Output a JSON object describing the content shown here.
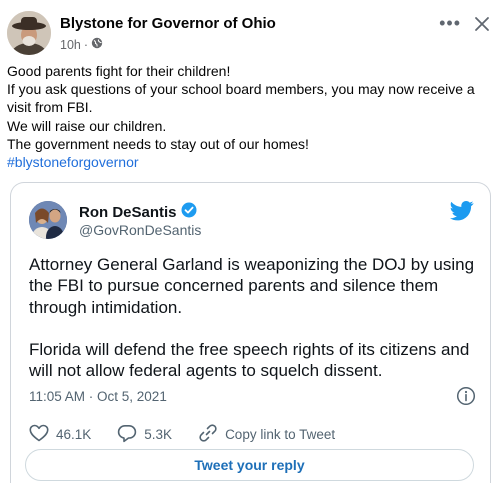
{
  "post": {
    "author": "Blystone for Governor of Ohio",
    "time": "10h",
    "separator": "·",
    "more_label": "•••",
    "lines": [
      "Good parents fight for their children!",
      "If you ask questions of your school board members, you may now receive a visit from FBI.",
      "We will raise our children.",
      "The government needs to stay out of our homes!"
    ],
    "hashtag": "#blystoneforgovernor"
  },
  "tweet": {
    "name": "Ron DeSantis",
    "handle": "@GovRonDeSantis",
    "paragraphs": [
      "Attorney General Garland is weaponizing the DOJ by using the FBI to pursue concerned parents and silence them through intimidation.",
      "Florida will defend the free speech rights of its citizens and will not allow federal agents to squelch dissent."
    ],
    "timestamp": "11:05 AM · Oct 5, 2021",
    "likes": "46.1K",
    "replies": "5.3K",
    "copy_link": "Copy link to Tweet",
    "reply_button": "Tweet your reply"
  },
  "colors": {
    "twitter_blue": "#1d9bf0",
    "hashtag": "#216fdb",
    "verified": "#1d9bf0"
  },
  "icons": [
    "globe-icon",
    "more-icon",
    "close-icon",
    "verified-badge-icon",
    "twitter-bird-icon",
    "info-icon",
    "heart-icon",
    "reply-icon",
    "link-icon"
  ]
}
